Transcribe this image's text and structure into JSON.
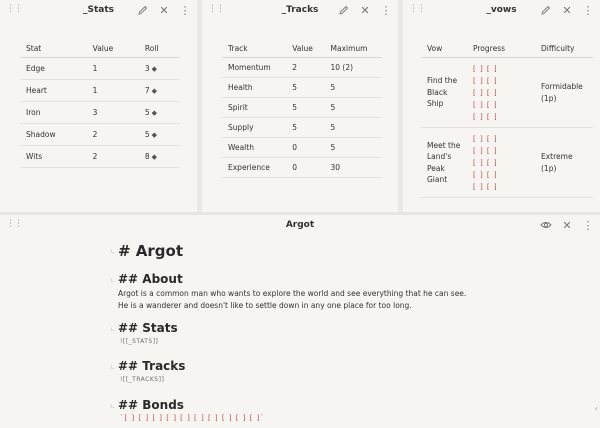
{
  "stats_pane": {
    "title": "_Stats",
    "columns": [
      "Stat",
      "Value",
      "Roll"
    ],
    "rows": [
      {
        "stat": "Edge",
        "value": "1",
        "roll": "3"
      },
      {
        "stat": "Heart",
        "value": "1",
        "roll": "7"
      },
      {
        "stat": "Iron",
        "value": "3",
        "roll": "5"
      },
      {
        "stat": "Shadow",
        "value": "2",
        "roll": "5"
      },
      {
        "stat": "Wits",
        "value": "2",
        "roll": "8"
      }
    ]
  },
  "tracks_pane": {
    "title": "_Tracks",
    "columns": [
      "Track",
      "Value",
      "Maximum"
    ],
    "rows": [
      {
        "track": "Momentum",
        "value": "2",
        "max": "10 (2)"
      },
      {
        "track": "Health",
        "value": "5",
        "max": "5"
      },
      {
        "track": "Spirit",
        "value": "5",
        "max": "5"
      },
      {
        "track": "Supply",
        "value": "5",
        "max": "5"
      },
      {
        "track": "Wealth",
        "value": "0",
        "max": "5"
      },
      {
        "track": "Experience",
        "value": "0",
        "max": "30"
      }
    ]
  },
  "vows_pane": {
    "title": "_vows",
    "columns": [
      "Vow",
      "Progress",
      "Difficulty"
    ],
    "rows": [
      {
        "vow": "Find the Black Ship",
        "progress": [
          "[ ] [ ]",
          "[ ] [ ]",
          "[ ] [ ]",
          "[ ] [ ]",
          "[ ] [ ]"
        ],
        "difficulty": "Formidable (1p)"
      },
      {
        "vow": "Meet the Land's Peak Giant",
        "progress": [
          "[ ] [ ]",
          "[ ] [ ]",
          "[ ] [ ]",
          "[ ] [ ]",
          "[ ] [ ]"
        ],
        "difficulty": "Extreme (1p)"
      }
    ]
  },
  "editor": {
    "title": "Argot",
    "h1": "# Argot",
    "about_heading": "## About",
    "about_text": "Argot is a common man who wants to explore the world and see everything that he can see. He is a wanderer and doesn't like to settle down in any one place for too long.",
    "stats_heading": "## Stats",
    "stats_embed": "![[_STATS]]",
    "tracks_heading": "## Tracks",
    "tracks_embed": "![[_TRACKS]]",
    "bonds_heading": "## Bonds",
    "bonds_text": "`[ ] [ ] [ ] [ ] [ ] [ ] [ ] [ ] [ ] [ ]`"
  },
  "icons": {
    "grip": "grip-icon",
    "edit": "pencil-icon",
    "close": "close-icon",
    "more": "more-icon",
    "preview": "eye-icon",
    "dice": "dice-icon"
  },
  "colors": {
    "checkbox": "#c44747",
    "background": "#f6f5f1"
  }
}
